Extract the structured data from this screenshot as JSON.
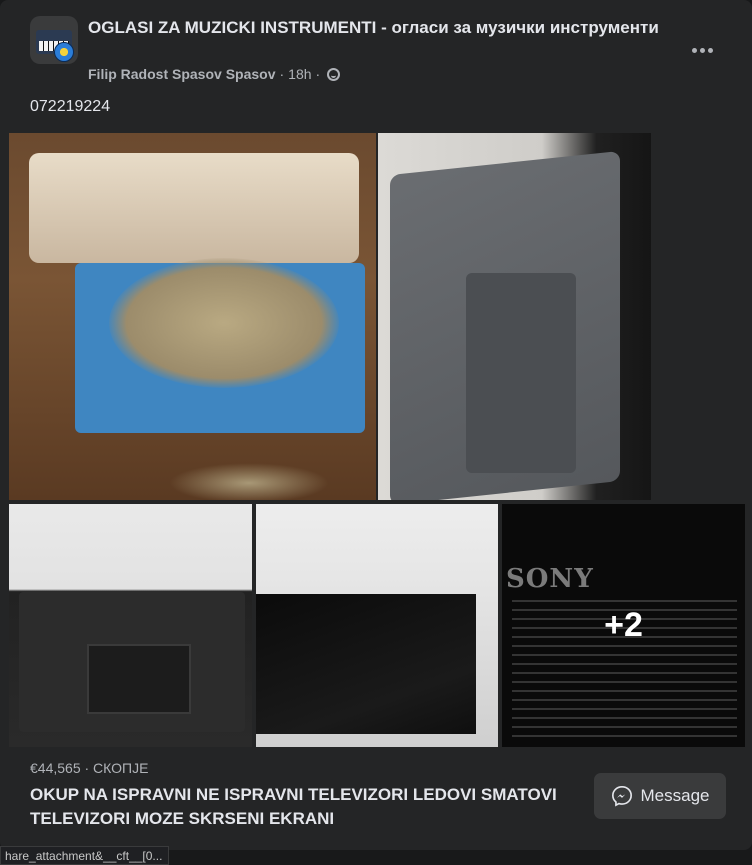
{
  "post": {
    "group_name": "OGLASI ZA MUZICKI INSTRUMENTI - огласи за музички инструменти",
    "author": "Filip Radost Spasov Spasov",
    "separator": "·",
    "time": "18h",
    "audience_icon": "globe-icon",
    "more_icon": "more-options-icon",
    "text": "072219224"
  },
  "photos": {
    "extra_count": "+2",
    "sony_brand": "SONY"
  },
  "listing": {
    "price_location": "€44,565 · СКОПЈЕ",
    "title": "OKUP NA ISPRAVNI NE ISPRAVNI TELEVIZORI LEDOVI SMATOVI TELEVIZORI MOZE SKRSENI EKRANI",
    "message_label": "Message",
    "message_icon": "messenger-icon"
  },
  "status_bar": {
    "url_text": "hare_attachment&__cft__[0..."
  },
  "colors": {
    "card_bg": "#242526",
    "page_bg": "#18191a",
    "button_bg": "#3a3b3c",
    "text_primary": "#e4e6eb",
    "text_secondary": "#b0b3b8"
  }
}
